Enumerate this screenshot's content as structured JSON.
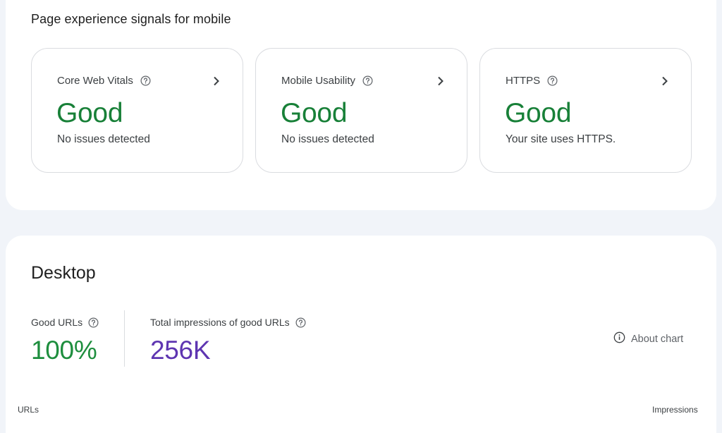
{
  "mobile_section": {
    "title": "Page experience signals for mobile",
    "cards": [
      {
        "label": "Core Web Vitals",
        "status": "Good",
        "detail": "No issues detected"
      },
      {
        "label": "Mobile Usability",
        "status": "Good",
        "detail": "No issues detected"
      },
      {
        "label": "HTTPS",
        "status": "Good",
        "detail": "Your site uses HTTPS."
      }
    ],
    "status_color": "#188038"
  },
  "desktop_section": {
    "title": "Desktop",
    "good_urls": {
      "label": "Good URLs",
      "value": "100%",
      "color": "#1e8e3e"
    },
    "impressions": {
      "label": "Total impressions of good URLs",
      "value": "256K",
      "color": "#5e35b1"
    },
    "about_chart_label": "About chart",
    "axis_left_label": "URLs",
    "axis_right_label": "Impressions"
  },
  "icons": {
    "help": "help-circle-icon",
    "chevron": "chevron-right-icon",
    "info": "info-circle-icon"
  }
}
